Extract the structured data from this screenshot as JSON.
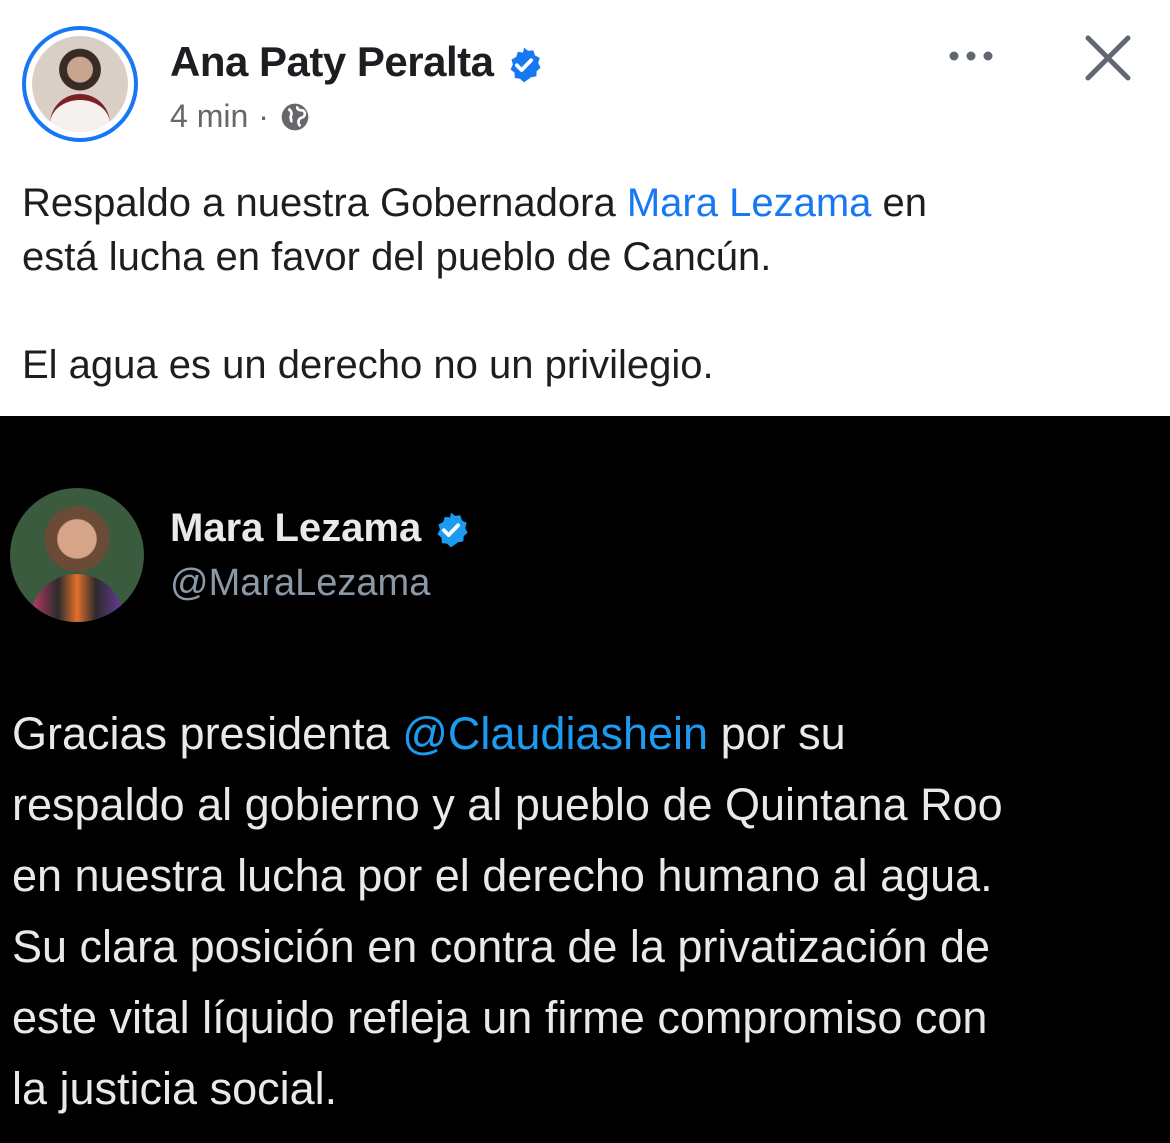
{
  "facebook_post": {
    "author_name": "Ana Paty Peralta",
    "time": "4 min",
    "separator": "·",
    "more_icon": "more-horizontal-icon",
    "close_icon": "close-icon",
    "text_line1_before": "Respaldo a nuestra Gobernadora ",
    "text_line1_mention": "Mara Lezama",
    "text_line1_after": " en",
    "text_line2": "está lucha en favor del pueblo de Cancún.",
    "text_line3": "El agua es un derecho no un privilegio.",
    "colors": {
      "mention": "#1877f2",
      "verified": "#1877f2"
    }
  },
  "embedded_tweet": {
    "author_name": "Mara Lezama",
    "handle": "@MaraLezama",
    "text_line1_before": "Gracias presidenta ",
    "text_line1_mention": "@Claudiashein",
    "text_line1_after": " por su",
    "text_line2": "respaldo al gobierno y al pueblo de Quintana Roo",
    "text_line3": "en nuestra lucha por el derecho humano al agua.",
    "text_line4": "Su clara posición en contra de la privatización de",
    "text_line5": "este vital líquido refleja un firme compromiso con",
    "text_line6": "la justicia social.",
    "colors": {
      "mention": "#1d9bf0",
      "verified": "#1d9bf0"
    }
  }
}
